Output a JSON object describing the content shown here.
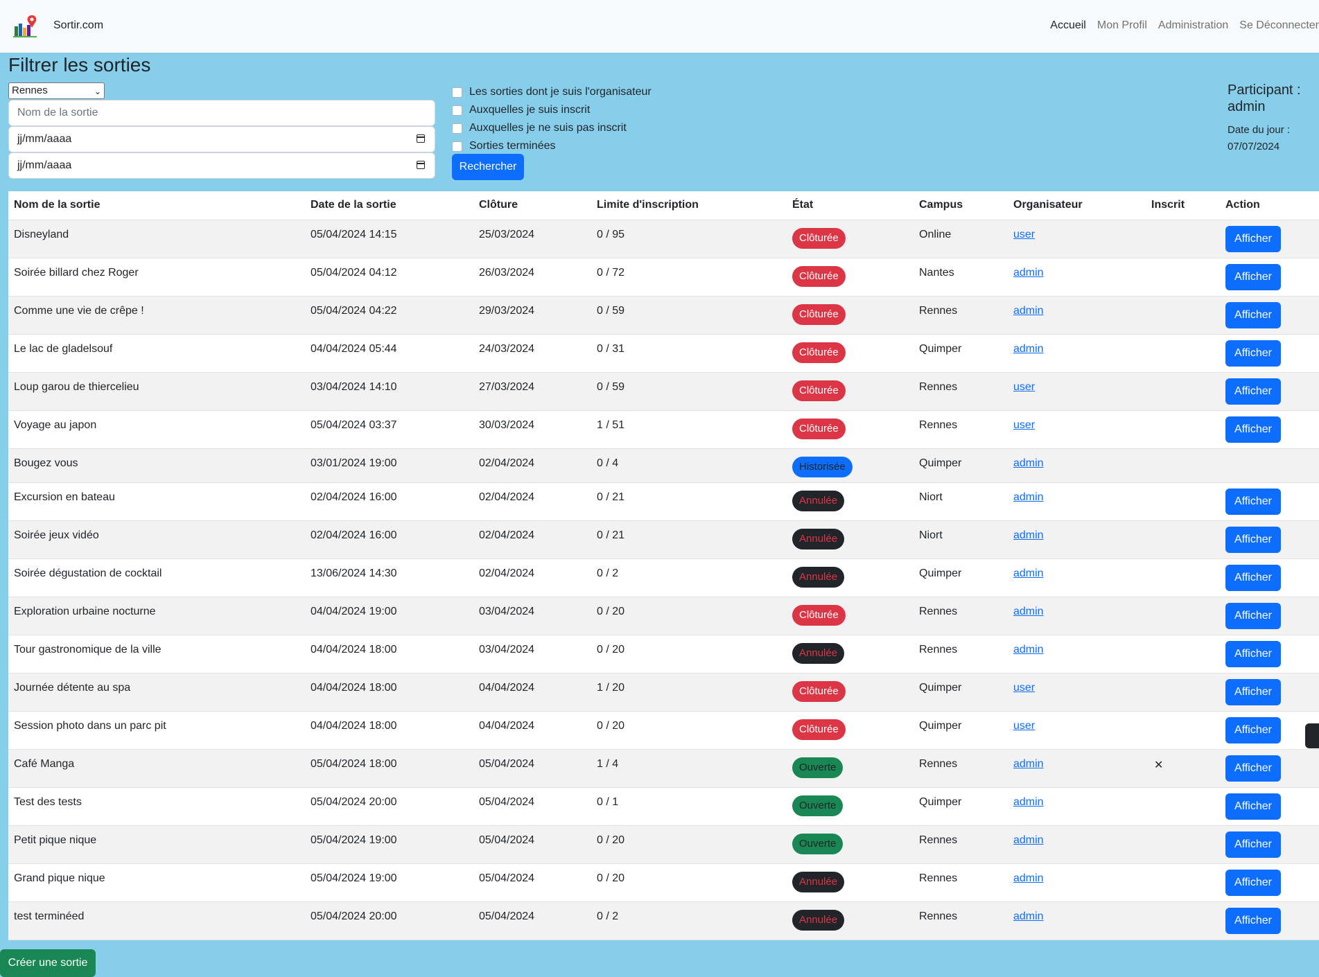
{
  "nav": {
    "brand": "Sortir.com",
    "links": [
      "Accueil",
      "Mon Profil",
      "Administration",
      "Se Déconnecter"
    ]
  },
  "filter": {
    "title": "Filtrer les sorties",
    "campus_selected": "Rennes",
    "name_placeholder": "Nom de la sortie",
    "date_start_placeholder": "jj/mm/aaaa",
    "date_end_placeholder": "jj/mm/aaaa",
    "checks": [
      "Les sorties dont je suis l'organisateur",
      "Auxquelles je suis inscrit",
      "Auxquelles je ne suis pas inscrit",
      "Sorties terminées"
    ],
    "search_label": "Rechercher"
  },
  "participant": {
    "label": "Participant : admin",
    "date_label": "Date du jour :",
    "date_value": "07/07/2024"
  },
  "table": {
    "headers": [
      "Nom de la sortie",
      "Date de la sortie",
      "Clôture",
      "Limite d'inscription",
      "État",
      "Campus",
      "Organisateur",
      "Inscrit",
      "Action"
    ],
    "action_label": "Afficher",
    "inscrit_mark": "✕",
    "rows": [
      {
        "name": "Disneyland",
        "date": "05/04/2024 14:15",
        "cloture": "25/03/2024",
        "limit": "0 / 95",
        "etat": "Clôturée",
        "etat_type": "closed",
        "campus": "Online",
        "org": "user",
        "inscrit": false,
        "action": true
      },
      {
        "name": "Soirée billard chez Roger",
        "date": "05/04/2024 04:12",
        "cloture": "26/03/2024",
        "limit": "0 / 72",
        "etat": "Clôturée",
        "etat_type": "closed",
        "campus": "Nantes",
        "org": "admin",
        "inscrit": false,
        "action": true
      },
      {
        "name": "Comme une vie de crêpe !",
        "date": "05/04/2024 04:22",
        "cloture": "29/03/2024",
        "limit": "0 / 59",
        "etat": "Clôturée",
        "etat_type": "closed",
        "campus": "Rennes",
        "org": "admin",
        "inscrit": false,
        "action": true
      },
      {
        "name": "Le lac de gladelsouf",
        "date": "04/04/2024 05:44",
        "cloture": "24/03/2024",
        "limit": "0 / 31",
        "etat": "Clôturée",
        "etat_type": "closed",
        "campus": "Quimper",
        "org": "admin",
        "inscrit": false,
        "action": true
      },
      {
        "name": "Loup garou de thiercelieu",
        "date": "03/04/2024 14:10",
        "cloture": "27/03/2024",
        "limit": "0 / 59",
        "etat": "Clôturée",
        "etat_type": "closed",
        "campus": "Rennes",
        "org": "user",
        "inscrit": false,
        "action": true
      },
      {
        "name": "Voyage au japon",
        "date": "05/04/2024 03:37",
        "cloture": "30/03/2024",
        "limit": "1 / 51",
        "etat": "Clôturée",
        "etat_type": "closed",
        "campus": "Rennes",
        "org": "user",
        "inscrit": false,
        "action": true
      },
      {
        "name": "Bougez vous",
        "date": "03/01/2024 19:00",
        "cloture": "02/04/2024",
        "limit": "0 / 4",
        "etat": "Historisée",
        "etat_type": "hist",
        "campus": "Quimper",
        "org": "admin",
        "inscrit": false,
        "action": false
      },
      {
        "name": "Excursion en bateau",
        "date": "02/04/2024 16:00",
        "cloture": "02/04/2024",
        "limit": "0 / 21",
        "etat": "Annulée",
        "etat_type": "cancel",
        "campus": "Niort",
        "org": "admin",
        "inscrit": false,
        "action": true
      },
      {
        "name": "Soirée jeux vidéo",
        "date": "02/04/2024 16:00",
        "cloture": "02/04/2024",
        "limit": "0 / 21",
        "etat": "Annulée",
        "etat_type": "cancel",
        "campus": "Niort",
        "org": "admin",
        "inscrit": false,
        "action": true
      },
      {
        "name": "Soirée dégustation de cocktail",
        "date": "13/06/2024 14:30",
        "cloture": "02/04/2024",
        "limit": "0 / 2",
        "etat": "Annulée",
        "etat_type": "cancel",
        "campus": "Quimper",
        "org": "admin",
        "inscrit": false,
        "action": true
      },
      {
        "name": "Exploration urbaine nocturne",
        "date": "04/04/2024 19:00",
        "cloture": "03/04/2024",
        "limit": "0 / 20",
        "etat": "Clôturée",
        "etat_type": "closed",
        "campus": "Rennes",
        "org": "admin",
        "inscrit": false,
        "action": true
      },
      {
        "name": "Tour gastronomique de la ville",
        "date": "04/04/2024 18:00",
        "cloture": "03/04/2024",
        "limit": "0 / 20",
        "etat": "Annulée",
        "etat_type": "cancel",
        "campus": "Rennes",
        "org": "admin",
        "inscrit": false,
        "action": true
      },
      {
        "name": "Journée détente au spa",
        "date": "04/04/2024 18:00",
        "cloture": "04/04/2024",
        "limit": "1 / 20",
        "etat": "Clôturée",
        "etat_type": "closed",
        "campus": "Quimper",
        "org": "user",
        "inscrit": false,
        "action": true
      },
      {
        "name": "Session photo dans un parc pit",
        "date": "04/04/2024 18:00",
        "cloture": "04/04/2024",
        "limit": "0 / 20",
        "etat": "Clôturée",
        "etat_type": "closed",
        "campus": "Quimper",
        "org": "user",
        "inscrit": false,
        "action": true
      },
      {
        "name": "Café Manga",
        "date": "05/04/2024 18:00",
        "cloture": "05/04/2024",
        "limit": "1 / 4",
        "etat": "Ouverte",
        "etat_type": "open",
        "campus": "Rennes",
        "org": "admin",
        "inscrit": true,
        "action": true
      },
      {
        "name": "Test des tests",
        "date": "05/04/2024 20:00",
        "cloture": "05/04/2024",
        "limit": "0 / 1",
        "etat": "Ouverte",
        "etat_type": "open",
        "campus": "Quimper",
        "org": "admin",
        "inscrit": false,
        "action": true
      },
      {
        "name": "Petit pique nique",
        "date": "05/04/2024 19:00",
        "cloture": "05/04/2024",
        "limit": "0 / 20",
        "etat": "Ouverte",
        "etat_type": "open",
        "campus": "Rennes",
        "org": "admin",
        "inscrit": false,
        "action": true
      },
      {
        "name": "Grand pique nique",
        "date": "05/04/2024 19:00",
        "cloture": "05/04/2024",
        "limit": "0 / 20",
        "etat": "Annulée",
        "etat_type": "cancel",
        "campus": "Rennes",
        "org": "admin",
        "inscrit": false,
        "action": true
      },
      {
        "name": "test terminéed",
        "date": "05/04/2024 20:00",
        "cloture": "05/04/2024",
        "limit": "0 / 2",
        "etat": "Annulée",
        "etat_type": "cancel",
        "campus": "Rennes",
        "org": "admin",
        "inscrit": false,
        "action": true
      }
    ]
  },
  "create_label": "Créer une sortie",
  "colors": {
    "page_bg": "#87ceeb",
    "primary": "#0d6efd",
    "danger": "#dc3545",
    "success": "#198754",
    "dark": "#212529"
  }
}
